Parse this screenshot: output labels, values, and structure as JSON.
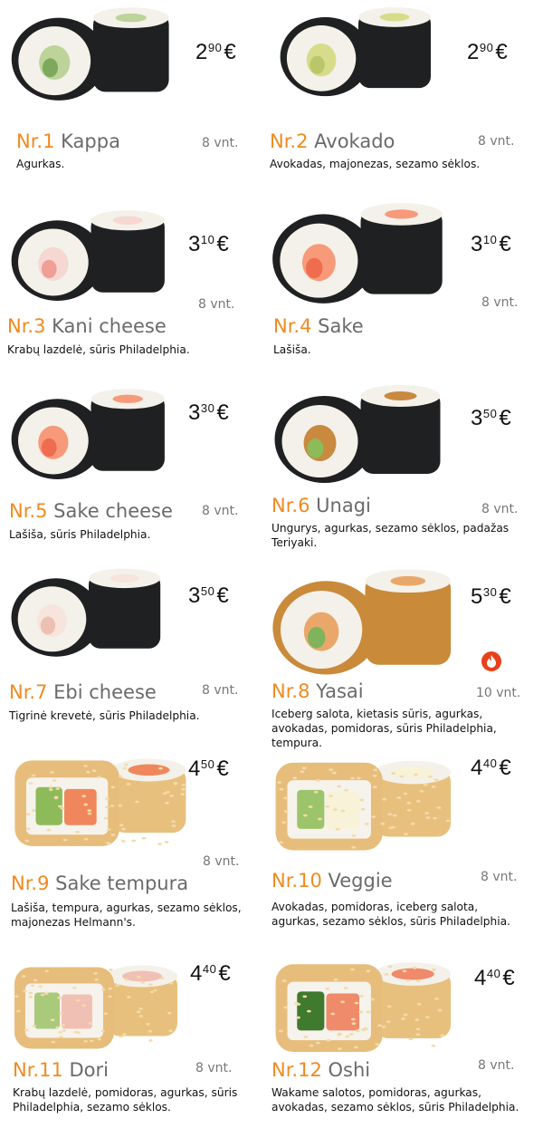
{
  "items": [
    {
      "nr": "Nr.1",
      "name": "Kappa",
      "int": "2",
      "dec": "90",
      "cur": "€",
      "pcs": "8 vnt.",
      "desc": "Agurkas.",
      "filling": "cucumber"
    },
    {
      "nr": "Nr.2",
      "name": "Avokado",
      "int": "2",
      "dec": "90",
      "cur": "€",
      "pcs": "8 vnt.",
      "desc": "Avokadas, majonezas, sezamo sėklos.",
      "filling": "avocado"
    },
    {
      "nr": "Nr.3",
      "name": "Kani cheese",
      "int": "3",
      "dec": "10",
      "cur": "€",
      "pcs": "8 vnt.",
      "desc": "Krabų lazdelė, sūris Philadelphia.",
      "filling": "crab"
    },
    {
      "nr": "Nr.4",
      "name": "Sake",
      "int": "3",
      "dec": "10",
      "cur": "€",
      "pcs": "8 vnt.",
      "desc": "Lašiša.",
      "filling": "salmon"
    },
    {
      "nr": "Nr.5",
      "name": "Sake cheese",
      "int": "3",
      "dec": "30",
      "cur": "€",
      "pcs": "8 vnt.",
      "desc": "Lašiša, sūris Philadelphia.",
      "filling": "salmon"
    },
    {
      "nr": "Nr.6",
      "name": "Unagi",
      "int": "3",
      "dec": "50",
      "cur": "€",
      "pcs": "8 vnt.",
      "desc": "Ungurys, agurkas, sezamo sėklos, padažas Teriyaki.",
      "filling": "eel"
    },
    {
      "nr": "Nr.7",
      "name": "Ebi cheese",
      "int": "3",
      "dec": "50",
      "cur": "€",
      "pcs": "8 vnt.",
      "desc": "Tigrinė krevetė, sūris Philadelphia.",
      "filling": "shrimp"
    },
    {
      "nr": "Nr.8",
      "name": "Yasai",
      "int": "5",
      "dec": "30",
      "cur": "€",
      "pcs": "10 vnt.",
      "desc": "Iceberg salota, kietasis sūris, agurkas, avokadas, pomidoras, sūris Philadelphia, tempura.",
      "filling": "tempura",
      "spicy": true
    },
    {
      "nr": "Nr.9",
      "name": "Sake tempura",
      "int": "4",
      "dec": "50",
      "cur": "€",
      "pcs": "8 vnt.",
      "desc": "Lašiša, tempura, agurkas, sezamo sėklos, majonezas Helmann's.",
      "filling": "uramaki-salmon"
    },
    {
      "nr": "Nr.10",
      "name": "Veggie",
      "int": "4",
      "dec": "40",
      "cur": "€",
      "pcs": "8 vnt.",
      "desc": "Avokadas, pomidoras, iceberg salota, agurkas, sezamo sėklos, sūris Philadelphia.",
      "filling": "uramaki-veg"
    },
    {
      "nr": "Nr.11",
      "name": "Dori",
      "int": "4",
      "dec": "40",
      "cur": "€",
      "pcs": "8 vnt.",
      "desc": "Krabų lazdelė, pomidoras, agurkas, sūris Philadelphia, sezamo sėklos.",
      "filling": "uramaki-crab"
    },
    {
      "nr": "Nr.12",
      "name": "Oshi",
      "int": "4",
      "dec": "40",
      "cur": "€",
      "pcs": "8 vnt.",
      "desc": "Wakame salotos, pomidoras, agurkas, avokadas, sezamo sėklos, sūris Philadelphia.",
      "filling": "uramaki-wakame"
    }
  ],
  "colors": {
    "accent": "#f08a1f",
    "name_gray": "#6a6a6a",
    "nori": "#1f2021",
    "rice": "#f4f1ea",
    "spicy": "#e8401a"
  },
  "icons": {
    "spicy": "flame-icon"
  }
}
